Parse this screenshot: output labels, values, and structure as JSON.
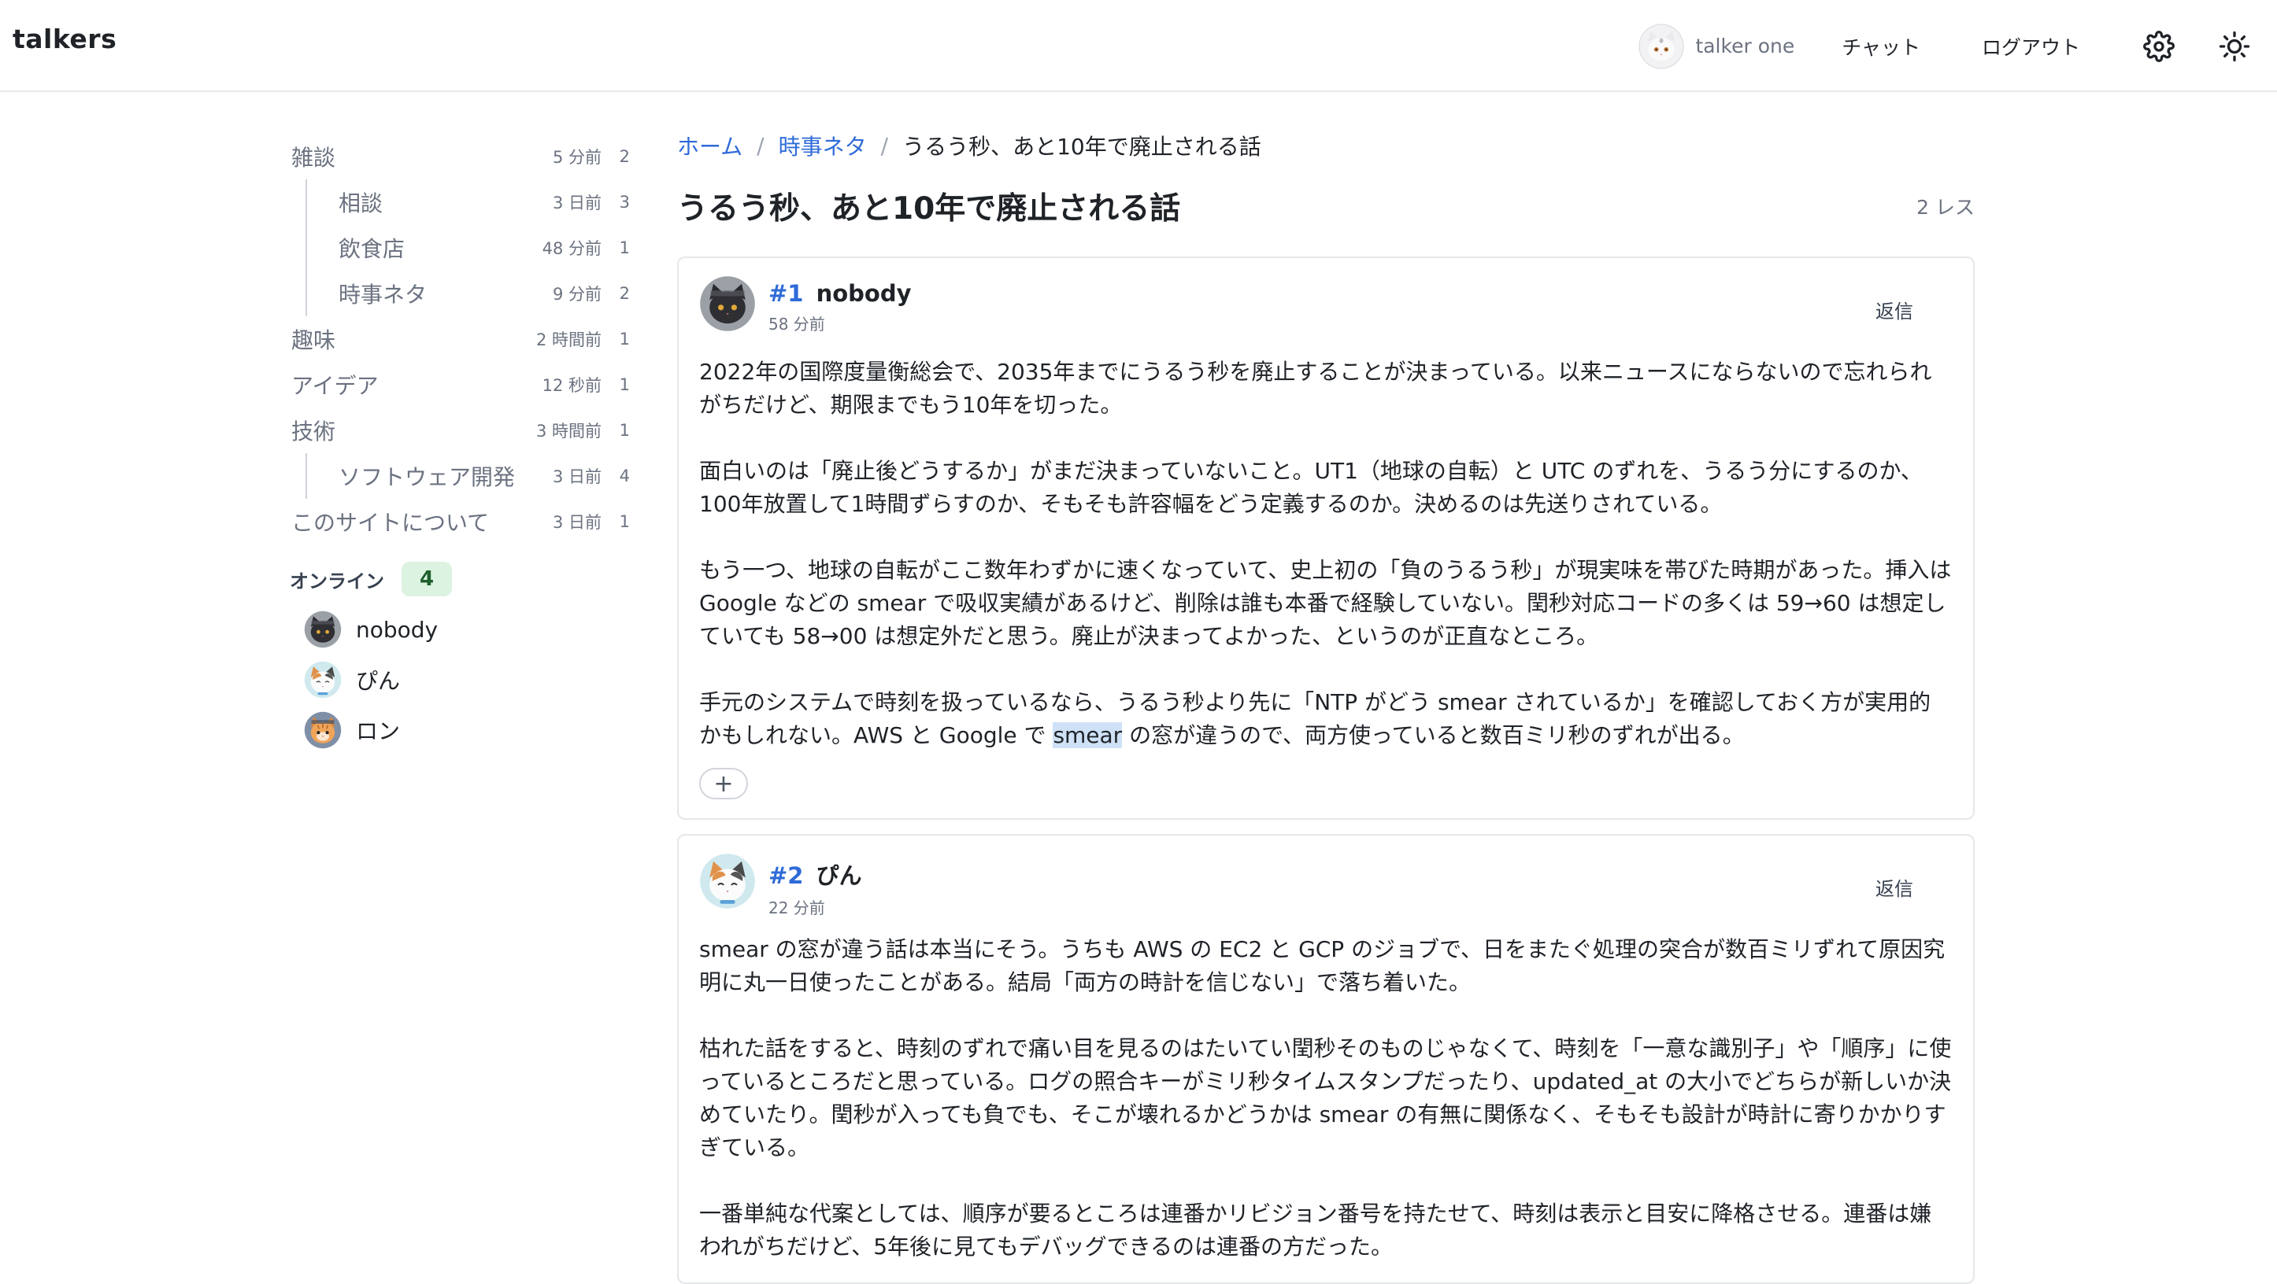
{
  "header": {
    "logo": "talkers",
    "user_name": "talker one",
    "chat_label": "チャット",
    "logout_label": "ログアウト",
    "icons": {
      "settings": "gear-icon",
      "theme": "sun-icon"
    }
  },
  "sidebar": {
    "categories": [
      {
        "name": "雑談",
        "time": "5 分前",
        "count": "2",
        "sub": false
      },
      {
        "name": "相談",
        "time": "3 日前",
        "count": "3",
        "sub": true
      },
      {
        "name": "飲食店",
        "time": "48 分前",
        "count": "1",
        "sub": true
      },
      {
        "name": "時事ネタ",
        "time": "9 分前",
        "count": "2",
        "sub": true
      },
      {
        "name": "趣味",
        "time": "2 時間前",
        "count": "1",
        "sub": false
      },
      {
        "name": "アイデア",
        "time": "12 秒前",
        "count": "1",
        "sub": false
      },
      {
        "name": "技術",
        "time": "3 時間前",
        "count": "1",
        "sub": false
      },
      {
        "name": "ソフトウェア開発",
        "time": "3 日前",
        "count": "4",
        "sub": true
      },
      {
        "name": "このサイトについて",
        "time": "3 日前",
        "count": "1",
        "sub": false
      }
    ],
    "online_label": "オンライン",
    "online_count": "4",
    "online_users": [
      {
        "name": "nobody",
        "avatar": "black-cat"
      },
      {
        "name": "ぴん",
        "avatar": "calico-cat"
      },
      {
        "name": "ロン",
        "avatar": "tabby-cat"
      }
    ]
  },
  "breadcrumb": {
    "home": "ホーム",
    "category": "時事ネタ",
    "current": "うるう秒、あと10年で廃止される話"
  },
  "thread": {
    "title": "うるう秒、あと10年で廃止される話",
    "reply_count": "2 レス"
  },
  "posts": [
    {
      "num": "#1",
      "author": "nobody",
      "time": "58 分前",
      "reply_label": "返信",
      "avatar": "black-cat",
      "paragraphs": [
        "2022年の国際度量衡総会で、2035年までにうるう秒を廃止することが決まっている。以来ニュースにならないので忘れられがちだけど、期限までもう10年を切った。",
        "面白いのは「廃止後どうするか」がまだ決まっていないこと。UT1（地球の自転）と UTC のずれを、うるう分にするのか、100年放置して1時間ずらすのか、そもそも許容幅をどう定義するのか。決めるのは先送りされている。",
        "もう一つ、地球の自転がここ数年わずかに速くなっていて、史上初の「負のうるう秒」が現実味を帯びた時期があった。挿入は Google などの smear で吸収実績があるけど、削除は誰も本番で経験していない。閏秒対応コードの多くは 59→60 は想定していても 58→00 は想定外だと思う。廃止が決まってよかった、というのが正直なところ。"
      ],
      "last_para_before": "手元のシステムで時刻を扱っているなら、うるう秒より先に「NTP がどう smear されているか」を確認しておく方が実用的かもしれない。AWS と Google で ",
      "last_para_highlight": "smear",
      "last_para_after": " の窓が違うので、両方使っていると数百ミリ秒のずれが出る。",
      "add_reaction": "+"
    },
    {
      "num": "#2",
      "author": "ぴん",
      "time": "22 分前",
      "reply_label": "返信",
      "avatar": "calico-cat",
      "paragraphs": [
        "smear の窓が違う話は本当にそう。うちも AWS の EC2 と GCP のジョブで、日をまたぐ処理の突合が数百ミリずれて原因究明に丸一日使ったことがある。結局「両方の時計を信じない」で落ち着いた。",
        "枯れた話をすると、時刻のずれで痛い目を見るのはたいてい閏秒そのものじゃなくて、時刻を「一意な識別子」や「順序」に使っているところだと思っている。ログの照合キーがミリ秒タイムスタンプだったり、updated_at の大小でどちらが新しいか決めていたり。閏秒が入っても負でも、そこが壊れるかどうかは smear の有無に関係なく、そもそも設計が時計に寄りかかりすぎている。",
        "一番単純な代案としては、順序が要るところは連番かリビジョン番号を持たせて、時刻は表示と目安に降格させる。連番は嫌われがちだけど、5年後に見てもデバッグできるのは連番の方だった。"
      ]
    }
  ]
}
